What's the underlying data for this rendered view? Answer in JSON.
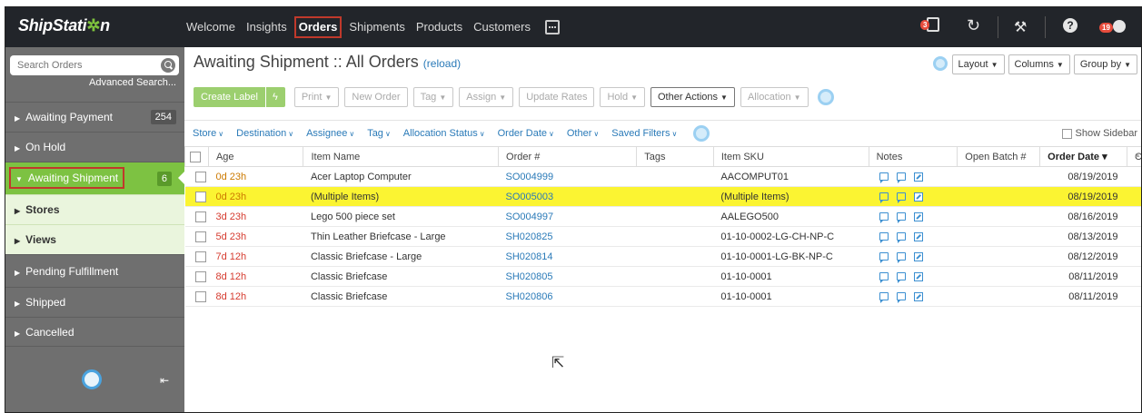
{
  "app": {
    "logo_prefix": "ShipStati",
    "logo_gear": "✲",
    "logo_suffix": "n"
  },
  "nav": {
    "items": [
      {
        "label": "Welcome",
        "active": false
      },
      {
        "label": "Insights",
        "active": false
      },
      {
        "label": "Orders",
        "active": true
      },
      {
        "label": "Shipments",
        "active": false
      },
      {
        "label": "Products",
        "active": false
      },
      {
        "label": "Customers",
        "active": false
      }
    ],
    "notification_count": "3",
    "profile_count": "19"
  },
  "sidebar": {
    "search_placeholder": "Search Orders",
    "advanced_search": "Advanced Search...",
    "items": [
      {
        "label": "Awaiting Payment",
        "count": "254"
      },
      {
        "label": "On Hold",
        "count": ""
      },
      {
        "label": "Awaiting Shipment",
        "count": "6"
      },
      {
        "label": "Pending Fulfillment",
        "count": ""
      },
      {
        "label": "Shipped",
        "count": ""
      },
      {
        "label": "Cancelled",
        "count": ""
      }
    ],
    "subitems": [
      {
        "label": "Stores"
      },
      {
        "label": "Views"
      }
    ]
  },
  "main": {
    "title": "Awaiting Shipment :: All Orders",
    "reload": "(reload)",
    "view_buttons": [
      "Layout",
      "Columns",
      "Group by"
    ],
    "toolbar": {
      "create_label": "Create Label",
      "bolt": "ϟ",
      "buttons": [
        {
          "label": "Print",
          "dropdown": true,
          "active": false
        },
        {
          "label": "New Order",
          "dropdown": false,
          "active": false
        },
        {
          "label": "Tag",
          "dropdown": true,
          "active": false
        },
        {
          "label": "Assign",
          "dropdown": true,
          "active": false
        },
        {
          "label": "Update Rates",
          "dropdown": false,
          "active": false
        },
        {
          "label": "Hold",
          "dropdown": true,
          "active": false
        },
        {
          "label": "Other Actions",
          "dropdown": true,
          "active": true
        },
        {
          "label": "Allocation",
          "dropdown": true,
          "active": false
        }
      ]
    },
    "filters": [
      "Store",
      "Destination",
      "Assignee",
      "Tag",
      "Allocation Status",
      "Order Date",
      "Other",
      "Saved Filters"
    ],
    "show_sidebar": "Show Sidebar",
    "columns": [
      "Age",
      "Item Name",
      "Order #",
      "Tags",
      "Item SKU",
      "Notes",
      "Open Batch #",
      "Order Date ▾",
      "C"
    ],
    "rows": [
      {
        "age": "0d 23h",
        "age_color": "orange",
        "item": "Acer Laptop Computer",
        "order": "SO004999",
        "tags": "",
        "sku": "AACOMPUT01",
        "batch": "",
        "date": "08/19/2019",
        "highlight": false
      },
      {
        "age": "0d 23h",
        "age_color": "orange",
        "item": "(Multiple Items)",
        "order": "SO005003",
        "tags": "",
        "sku": "(Multiple Items)",
        "batch": "",
        "date": "08/19/2019",
        "highlight": true
      },
      {
        "age": "3d 23h",
        "age_color": "red",
        "item": "Lego 500 piece set",
        "order": "SO004997",
        "tags": "",
        "sku": "AALEGO500",
        "batch": "",
        "date": "08/16/2019",
        "highlight": false
      },
      {
        "age": "5d 23h",
        "age_color": "red",
        "item": "Thin Leather Briefcase - Large",
        "order": "SH020825",
        "tags": "",
        "sku": "01-10-0002-LG-CH-NP-C",
        "batch": "",
        "date": "08/13/2019",
        "highlight": false
      },
      {
        "age": "7d 12h",
        "age_color": "red",
        "item": "Classic Briefcase - Large",
        "order": "SH020814",
        "tags": "",
        "sku": "01-10-0001-LG-BK-NP-C",
        "batch": "",
        "date": "08/12/2019",
        "highlight": false
      },
      {
        "age": "8d 12h",
        "age_color": "red",
        "item": "Classic Briefcase",
        "order": "SH020805",
        "tags": "",
        "sku": "01-10-0001",
        "batch": "",
        "date": "08/11/2019",
        "highlight": false
      },
      {
        "age": "8d 12h",
        "age_color": "red",
        "item": "Classic Briefcase",
        "order": "SH020806",
        "tags": "",
        "sku": "01-10-0001",
        "batch": "",
        "date": "08/11/2019",
        "highlight": false
      }
    ]
  },
  "colors": {
    "nav_bg": "#22252a",
    "sidebar_bg": "#6f6f6f",
    "accent_green": "#7dc242",
    "link_blue": "#2a7ab8",
    "highlight_yellow": "#fbf432",
    "annotation_red": "#c0392b"
  }
}
